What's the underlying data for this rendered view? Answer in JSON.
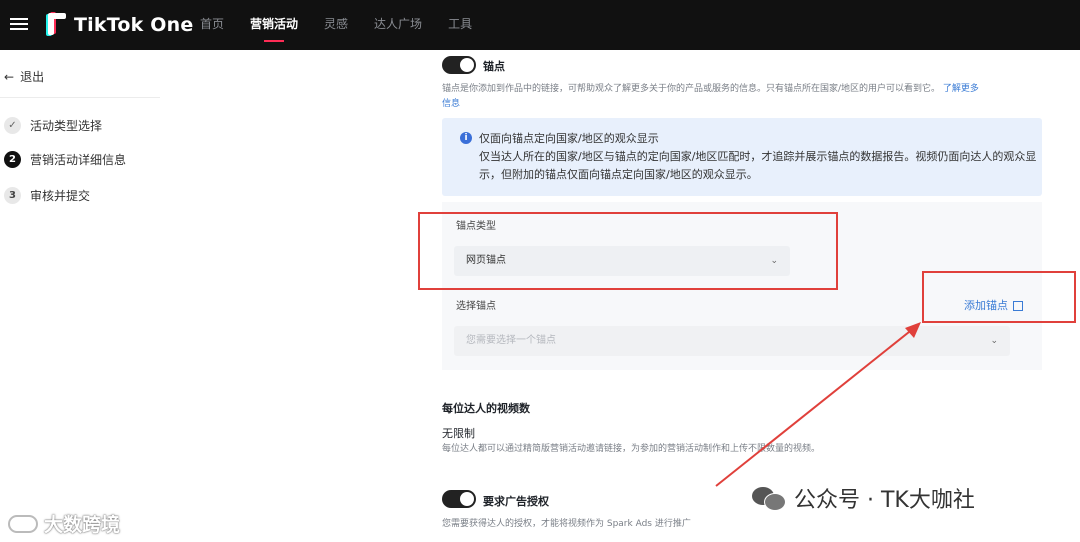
{
  "app": {
    "brand": "TikTok One"
  },
  "nav": {
    "items": [
      "首页",
      "营销活动",
      "灵感",
      "达人广场",
      "工具"
    ],
    "active_index": 1
  },
  "sidebar": {
    "back_label": "退出",
    "steps": [
      {
        "badge": "✓",
        "label": "活动类型选择",
        "state": "done"
      },
      {
        "badge": "2",
        "label": "营销活动详细信息",
        "state": "current"
      },
      {
        "badge": "3",
        "label": "审核并提交",
        "state": "todo"
      }
    ]
  },
  "anchor_section": {
    "toggle_on": true,
    "title": "锚点",
    "description": "锚点是你添加到作品中的链接，可帮助观众了解更多关于你的产品或服务的信息。只有锚点所在国家/地区的用户可以看到它。",
    "learn_more": "了解更多",
    "learn_more_tail": "信息",
    "info": {
      "title": "仅面向锚点定向国家/地区的观众显示",
      "body": "仅当达人所在的国家/地区与锚点的定向国家/地区匹配时，才追踪并展示锚点的数据报告。视频仍面向达人的观众显示，但附加的锚点仅面向锚点定向国家/地区的观众显示。"
    },
    "anchor_type_label": "锚点类型",
    "anchor_type_value": "网页锚点",
    "select_anchor_label": "选择锚点",
    "add_anchor_label": "添加锚点",
    "select_anchor_placeholder": "您需要选择一个锚点"
  },
  "videos_section": {
    "title": "每位达人的视频数",
    "value": "无限制",
    "description": "每位达人都可以通过精简版营销活动邀请链接，为参加的营销活动制作和上传不限数量的视频。"
  },
  "ad_auth_section": {
    "toggle_on": true,
    "title": "要求广告授权",
    "description": "您需要获得达人的授权，才能将视频作为 Spark Ads 进行推广"
  },
  "watermarks": {
    "left": "大数跨境",
    "right": "公众号 · TK大咖社"
  },
  "colors": {
    "accent_red": "#fe2c55",
    "accent_cyan": "#25f4ee",
    "link_blue": "#3a7bd5",
    "annotation_red": "#e0403b"
  }
}
